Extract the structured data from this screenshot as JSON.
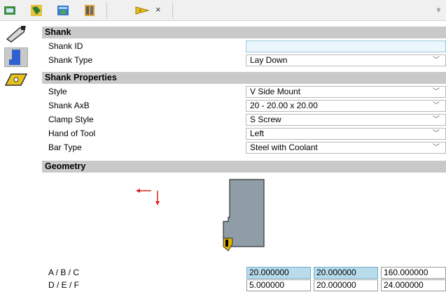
{
  "toolbar": {
    "icons": [
      "tool-library-icon",
      "holder-icon",
      "assembly-icon",
      "catalog-icon",
      "insert-tab-icon"
    ],
    "close_label": "×",
    "pin_label": "ᵩ"
  },
  "sidebar": {
    "items": [
      {
        "icon": "cutter-icon",
        "selected": false
      },
      {
        "icon": "shank-icon",
        "selected": true
      },
      {
        "icon": "insert-icon",
        "selected": false
      }
    ]
  },
  "shank": {
    "title": "Shank",
    "shank_id_label": "Shank ID",
    "shank_id_value": "",
    "shank_type_label": "Shank Type",
    "shank_type_value": "Lay Down"
  },
  "properties": {
    "title": "Shank Properties",
    "rows": [
      {
        "label": "Style",
        "value": "V Side Mount"
      },
      {
        "label": "Shank AxB",
        "value": "20 - 20.00 x 20.00"
      },
      {
        "label": "Clamp Style",
        "value": "S Screw"
      },
      {
        "label": "Hand of Tool",
        "value": "Left"
      },
      {
        "label": "Bar Type",
        "value": "Steel with Coolant"
      }
    ]
  },
  "geometry": {
    "title": "Geometry",
    "abc_label": "A / B / C",
    "abc_values": [
      "20.000000",
      "20.000000",
      "160.000000"
    ],
    "def_label": "D / E / F",
    "def_values": [
      "5.000000",
      "20.000000",
      "24.000000"
    ]
  },
  "colors": {
    "accent_arrow": "#e02020",
    "shank_fill": "#8f9ea6",
    "insert_fill": "#e3b400"
  }
}
